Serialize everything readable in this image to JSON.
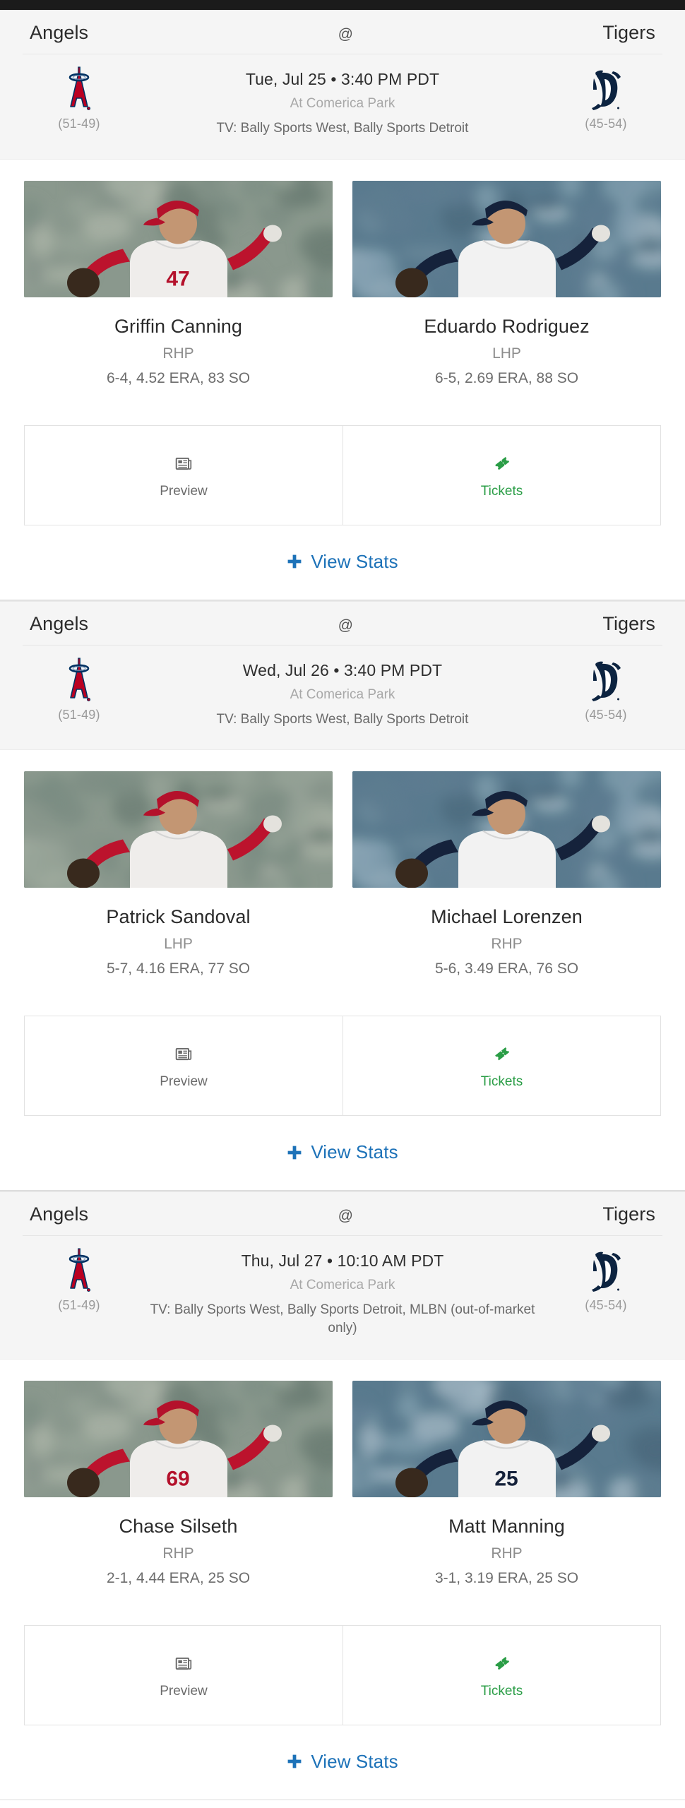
{
  "theme": {
    "accent_blue": "#1d72b8",
    "tickets_green": "#2a9d46",
    "angels_red": "#BA0021",
    "angels_navy": "#003263",
    "tigers_navy": "#0C2340",
    "panel_bg": "#f5f5f5"
  },
  "icons": {
    "preview": "newspaper-icon",
    "tickets": "ticket-icon",
    "view_stats": "plus-icon"
  },
  "labels": {
    "preview": "Preview",
    "tickets": "Tickets",
    "view_stats": "View Stats",
    "at_symbol": "@"
  },
  "games": [
    {
      "away_team": "Angels",
      "home_team": "Tigers",
      "away_record": "(51-49)",
      "home_record": "(45-54)",
      "datetime": "Tue, Jul 25 • 3:40 PM PDT",
      "venue": "At Comerica Park",
      "tv": "TV: Bally Sports West, Bally Sports Detroit",
      "pitchers": [
        {
          "name": "Griffin Canning",
          "hand": "RHP",
          "stats": "6-4, 4.52 ERA, 83 SO",
          "team": "angels",
          "jersey": "47"
        },
        {
          "name": "Eduardo Rodriguez",
          "hand": "LHP",
          "stats": "6-5, 2.69 ERA, 88 SO",
          "team": "tigers",
          "jersey": ""
        }
      ]
    },
    {
      "away_team": "Angels",
      "home_team": "Tigers",
      "away_record": "(51-49)",
      "home_record": "(45-54)",
      "datetime": "Wed, Jul 26 • 3:40 PM PDT",
      "venue": "At Comerica Park",
      "tv": "TV: Bally Sports West, Bally Sports Detroit",
      "pitchers": [
        {
          "name": "Patrick Sandoval",
          "hand": "LHP",
          "stats": "5-7, 4.16 ERA, 77 SO",
          "team": "angels",
          "jersey": ""
        },
        {
          "name": "Michael Lorenzen",
          "hand": "RHP",
          "stats": "5-6, 3.49 ERA, 76 SO",
          "team": "tigers",
          "jersey": ""
        }
      ]
    },
    {
      "away_team": "Angels",
      "home_team": "Tigers",
      "away_record": "(51-49)",
      "home_record": "(45-54)",
      "datetime": "Thu, Jul 27 • 10:10 AM PDT",
      "venue": "At Comerica Park",
      "tv": "TV: Bally Sports West, Bally Sports Detroit, MLBN (out-of-market only)",
      "pitchers": [
        {
          "name": "Chase Silseth",
          "hand": "RHP",
          "stats": "2-1, 4.44 ERA, 25 SO",
          "team": "angels",
          "jersey": "69"
        },
        {
          "name": "Matt Manning",
          "hand": "RHP",
          "stats": "3-1, 3.19 ERA, 25 SO",
          "team": "tigers",
          "jersey": "25"
        }
      ]
    }
  ]
}
